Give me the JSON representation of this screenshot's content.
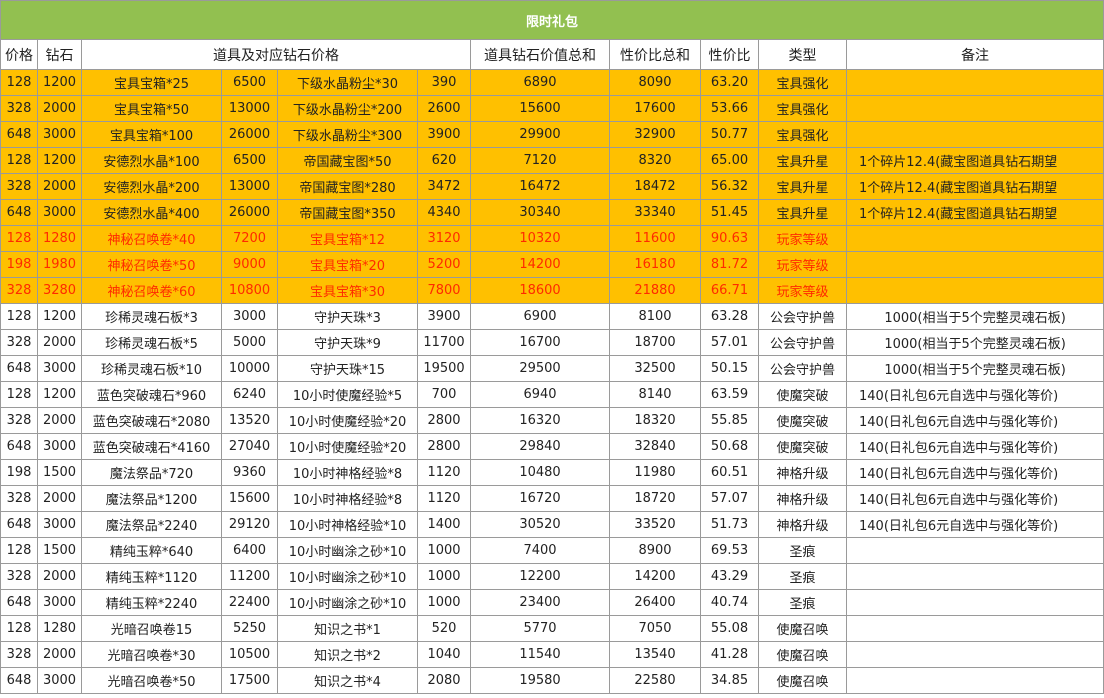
{
  "title": "限时礼包",
  "headers": {
    "price": "价格",
    "diamond": "钻石",
    "items": "道具及对应钻石价格",
    "item_total": "道具钻石价值总和",
    "value_total": "性价比总和",
    "ratio": "性价比",
    "type": "类型",
    "note": "备注"
  },
  "rows": [
    {
      "style": "orange",
      "price": "128",
      "diamond": "1200",
      "item1": "宝具宝箱*25",
      "val1": "6500",
      "item2": "下级水晶粉尘*30",
      "val2": "390",
      "item_total": "6890",
      "value_total": "8090",
      "ratio": "63.20",
      "type": "宝具强化",
      "note": ""
    },
    {
      "style": "orange",
      "price": "328",
      "diamond": "2000",
      "item1": "宝具宝箱*50",
      "val1": "13000",
      "item2": "下级水晶粉尘*200",
      "val2": "2600",
      "item_total": "15600",
      "value_total": "17600",
      "ratio": "53.66",
      "type": "宝具强化",
      "note": ""
    },
    {
      "style": "orange",
      "price": "648",
      "diamond": "3000",
      "item1": "宝具宝箱*100",
      "val1": "26000",
      "item2": "下级水晶粉尘*300",
      "val2": "3900",
      "item_total": "29900",
      "value_total": "32900",
      "ratio": "50.77",
      "type": "宝具强化",
      "note": ""
    },
    {
      "style": "orange",
      "price": "128",
      "diamond": "1200",
      "item1": "安德烈水晶*100",
      "val1": "6500",
      "item2": "帝国藏宝图*50",
      "val2": "620",
      "item_total": "7120",
      "value_total": "8320",
      "ratio": "65.00",
      "type": "宝具升星",
      "note": "1个碎片12.4(藏宝图道具钻石期望"
    },
    {
      "style": "orange",
      "price": "328",
      "diamond": "2000",
      "item1": "安德烈水晶*200",
      "val1": "13000",
      "item2": "帝国藏宝图*280",
      "val2": "3472",
      "item_total": "16472",
      "value_total": "18472",
      "ratio": "56.32",
      "type": "宝具升星",
      "note": "1个碎片12.4(藏宝图道具钻石期望"
    },
    {
      "style": "orange",
      "price": "648",
      "diamond": "3000",
      "item1": "安德烈水晶*400",
      "val1": "26000",
      "item2": "帝国藏宝图*350",
      "val2": "4340",
      "item_total": "30340",
      "value_total": "33340",
      "ratio": "51.45",
      "type": "宝具升星",
      "note": "1个碎片12.4(藏宝图道具钻石期望"
    },
    {
      "style": "red",
      "price": "128",
      "diamond": "1280",
      "item1": "神秘召唤卷*40",
      "val1": "7200",
      "item2": "宝具宝箱*12",
      "val2": "3120",
      "item_total": "10320",
      "value_total": "11600",
      "ratio": "90.63",
      "type": "玩家等级",
      "note": ""
    },
    {
      "style": "red",
      "price": "198",
      "diamond": "1980",
      "item1": "神秘召唤卷*50",
      "val1": "9000",
      "item2": "宝具宝箱*20",
      "val2": "5200",
      "item_total": "14200",
      "value_total": "16180",
      "ratio": "81.72",
      "type": "玩家等级",
      "note": ""
    },
    {
      "style": "red",
      "price": "328",
      "diamond": "3280",
      "item1": "神秘召唤卷*60",
      "val1": "10800",
      "item2": "宝具宝箱*30",
      "val2": "7800",
      "item_total": "18600",
      "value_total": "21880",
      "ratio": "66.71",
      "type": "玩家等级",
      "note": ""
    },
    {
      "style": "plain",
      "price": "128",
      "diamond": "1200",
      "item1": "珍稀灵魂石板*3",
      "val1": "3000",
      "item2": "守护天珠*3",
      "val2": "3900",
      "item_total": "6900",
      "value_total": "8100",
      "ratio": "63.28",
      "type": "公会守护兽",
      "note": "1000(相当于5个完整灵魂石板)"
    },
    {
      "style": "plain",
      "price": "328",
      "diamond": "2000",
      "item1": "珍稀灵魂石板*5",
      "val1": "5000",
      "item2": "守护天珠*9",
      "val2": "11700",
      "item_total": "16700",
      "value_total": "18700",
      "ratio": "57.01",
      "type": "公会守护兽",
      "note": "1000(相当于5个完整灵魂石板)"
    },
    {
      "style": "plain",
      "price": "648",
      "diamond": "3000",
      "item1": "珍稀灵魂石板*10",
      "val1": "10000",
      "item2": "守护天珠*15",
      "val2": "19500",
      "item_total": "29500",
      "value_total": "32500",
      "ratio": "50.15",
      "type": "公会守护兽",
      "note": "1000(相当于5个完整灵魂石板)"
    },
    {
      "style": "plain",
      "price": "128",
      "diamond": "1200",
      "item1": "蓝色突破魂石*960",
      "val1": "6240",
      "item2": "10小时使魔经验*5",
      "val2": "700",
      "item_total": "6940",
      "value_total": "8140",
      "ratio": "63.59",
      "type": "使魔突破",
      "note": "140(日礼包6元自选中与强化等价)"
    },
    {
      "style": "plain",
      "price": "328",
      "diamond": "2000",
      "item1": "蓝色突破魂石*2080",
      "val1": "13520",
      "item2": "10小时使魔经验*20",
      "val2": "2800",
      "item_total": "16320",
      "value_total": "18320",
      "ratio": "55.85",
      "type": "使魔突破",
      "note": "140(日礼包6元自选中与强化等价)"
    },
    {
      "style": "plain",
      "price": "648",
      "diamond": "3000",
      "item1": "蓝色突破魂石*4160",
      "val1": "27040",
      "item2": "10小时使魔经验*20",
      "val2": "2800",
      "item_total": "29840",
      "value_total": "32840",
      "ratio": "50.68",
      "type": "使魔突破",
      "note": "140(日礼包6元自选中与强化等价)"
    },
    {
      "style": "plain",
      "price": "198",
      "diamond": "1500",
      "item1": "魔法祭品*720",
      "val1": "9360",
      "item2": "10小时神格经验*8",
      "val2": "1120",
      "item_total": "10480",
      "value_total": "11980",
      "ratio": "60.51",
      "type": "神格升级",
      "note": "140(日礼包6元自选中与强化等价)"
    },
    {
      "style": "plain",
      "price": "328",
      "diamond": "2000",
      "item1": "魔法祭品*1200",
      "val1": "15600",
      "item2": "10小时神格经验*8",
      "val2": "1120",
      "item_total": "16720",
      "value_total": "18720",
      "ratio": "57.07",
      "type": "神格升级",
      "note": "140(日礼包6元自选中与强化等价)"
    },
    {
      "style": "plain",
      "price": "648",
      "diamond": "3000",
      "item1": "魔法祭品*2240",
      "val1": "29120",
      "item2": "10小时神格经验*10",
      "val2": "1400",
      "item_total": "30520",
      "value_total": "33520",
      "ratio": "51.73",
      "type": "神格升级",
      "note": "140(日礼包6元自选中与强化等价)"
    },
    {
      "style": "plain",
      "price": "128",
      "diamond": "1500",
      "item1": "精纯玉粹*640",
      "val1": "6400",
      "item2": "10小时幽涂之砂*10",
      "val2": "1000",
      "item_total": "7400",
      "value_total": "8900",
      "ratio": "69.53",
      "type": "圣痕",
      "note": ""
    },
    {
      "style": "plain",
      "price": "328",
      "diamond": "2000",
      "item1": "精纯玉粹*1120",
      "val1": "11200",
      "item2": "10小时幽涂之砂*10",
      "val2": "1000",
      "item_total": "12200",
      "value_total": "14200",
      "ratio": "43.29",
      "type": "圣痕",
      "note": ""
    },
    {
      "style": "plain",
      "price": "648",
      "diamond": "3000",
      "item1": "精纯玉粹*2240",
      "val1": "22400",
      "item2": "10小时幽涂之砂*10",
      "val2": "1000",
      "item_total": "23400",
      "value_total": "26400",
      "ratio": "40.74",
      "type": "圣痕",
      "note": ""
    },
    {
      "style": "plain",
      "price": "128",
      "diamond": "1280",
      "item1": "光暗召唤卷15",
      "val1": "5250",
      "item2": "知识之书*1",
      "val2": "520",
      "item_total": "5770",
      "value_total": "7050",
      "ratio": "55.08",
      "type": "使魔召唤",
      "note": ""
    },
    {
      "style": "plain",
      "price": "328",
      "diamond": "2000",
      "item1": "光暗召唤卷*30",
      "val1": "10500",
      "item2": "知识之书*2",
      "val2": "1040",
      "item_total": "11540",
      "value_total": "13540",
      "ratio": "41.28",
      "type": "使魔召唤",
      "note": ""
    },
    {
      "style": "plain",
      "price": "648",
      "diamond": "3000",
      "item1": "光暗召唤卷*50",
      "val1": "17500",
      "item2": "知识之书*4",
      "val2": "2080",
      "item_total": "19580",
      "value_total": "22580",
      "ratio": "34.85",
      "type": "使魔召唤",
      "note": ""
    }
  ],
  "colors": {
    "title_bg": "#92c050",
    "highlight_bg": "#ffc000",
    "highlight_text": "#ff2a00",
    "grid": "#9a9a9a"
  }
}
